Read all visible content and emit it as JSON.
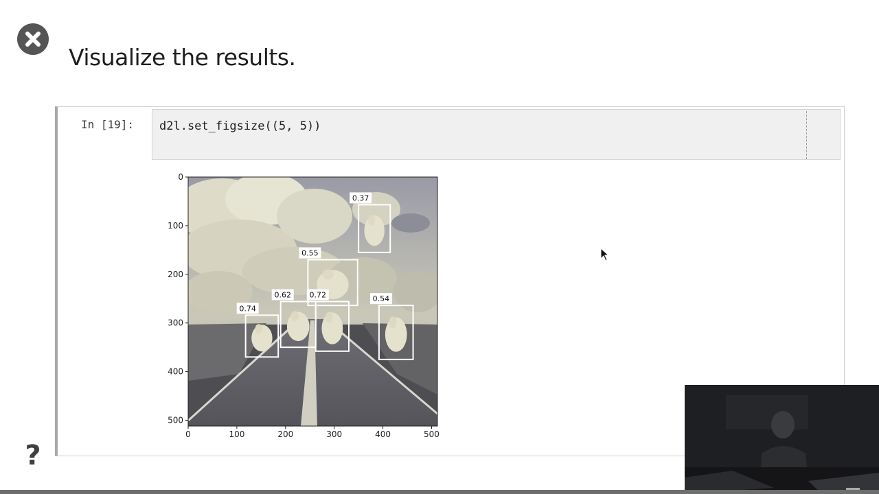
{
  "heading": "Visualize the results.",
  "help_glyph": "?",
  "cell": {
    "prompt": "In [19]:",
    "code": "d2l.set_figsize((5, 5))"
  },
  "chart_data": {
    "type": "image",
    "xlim": [
      0,
      512
    ],
    "ylim": [
      512,
      0
    ],
    "xticks": [
      0,
      100,
      200,
      300,
      400,
      500
    ],
    "yticks": [
      0,
      100,
      200,
      300,
      400,
      500
    ],
    "xtick_labels": [
      "0",
      "100",
      "200",
      "300",
      "400",
      "500"
    ],
    "ytick_labels": [
      "0",
      "100",
      "200",
      "300",
      "400",
      "500"
    ],
    "boxes": [
      {
        "label": "0.37",
        "x1": 350,
        "y1": 57,
        "x2": 415,
        "y2": 155
      },
      {
        "label": "0.55",
        "x1": 246,
        "y1": 170,
        "x2": 348,
        "y2": 264
      },
      {
        "label": "0.62",
        "x1": 190,
        "y1": 256,
        "x2": 262,
        "y2": 350
      },
      {
        "label": "0.72",
        "x1": 262,
        "y1": 256,
        "x2": 330,
        "y2": 358
      },
      {
        "label": "0.54",
        "x1": 392,
        "y1": 264,
        "x2": 462,
        "y2": 375
      },
      {
        "label": "0.74",
        "x1": 118,
        "y1": 284,
        "x2": 185,
        "y2": 370
      }
    ]
  },
  "icons": {
    "close": "close-icon",
    "help": "help-icon",
    "cursor": "mouse-pointer-icon"
  }
}
